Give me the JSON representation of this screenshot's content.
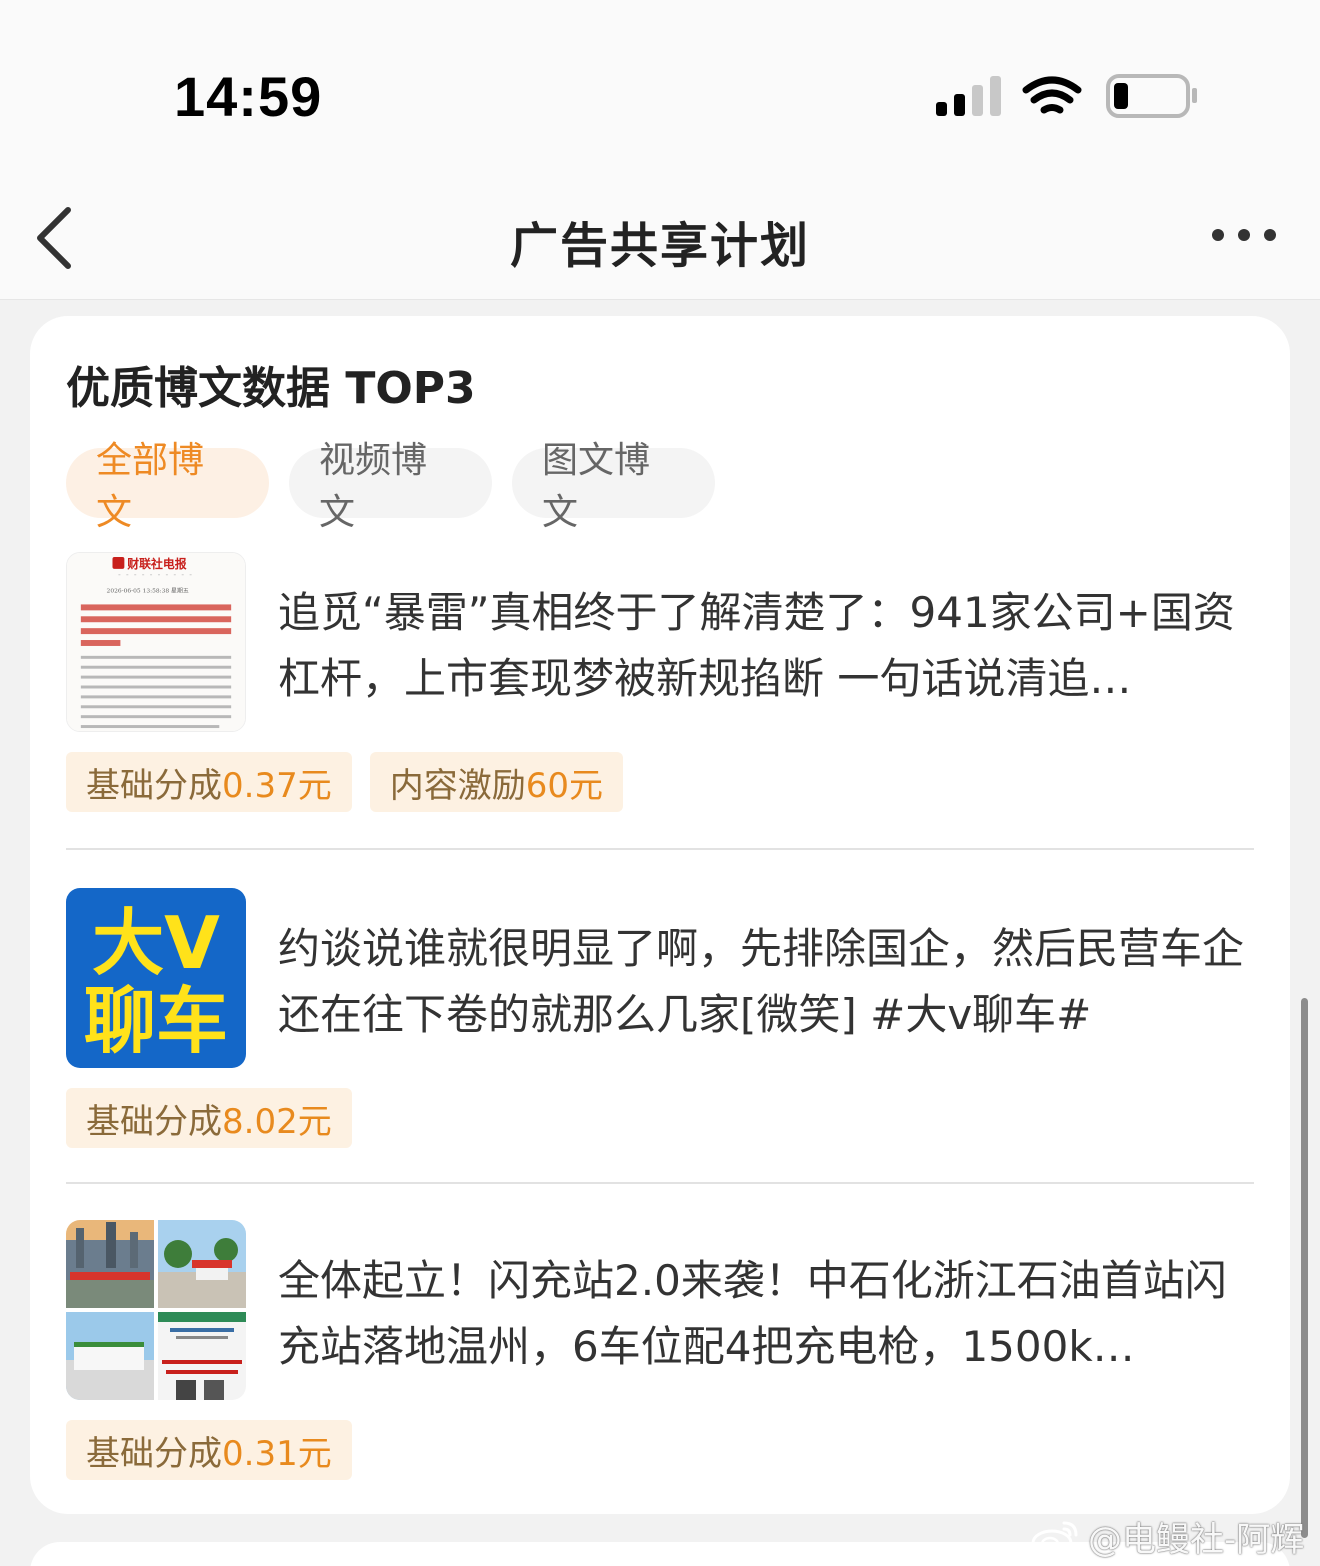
{
  "status_bar": {
    "time": "14:59"
  },
  "nav": {
    "title": "广告共享计划"
  },
  "section": {
    "title": "优质博文数据 TOP3",
    "tabs": [
      {
        "label": "全部博文",
        "active": true
      },
      {
        "label": "视频博文",
        "active": false
      },
      {
        "label": "图文博文",
        "active": false
      }
    ]
  },
  "posts": [
    {
      "thumb": {
        "kind": "news-document",
        "header": "财联社电报",
        "dateline": "2026-06-05 13:58:38 星期五",
        "headline": "【独家|有地方摸排辖区企业与追觅合作情况？地方人士回应：系市里统一部署，其所在区域初排没有相关的情况】"
      },
      "text": "追觅“暴雷”真相终于了解清楚了：941家公司+国资杠杆，上市套现梦被新规掐断 一句话说清追…",
      "badges": [
        {
          "label": "基础分成",
          "amount": "0.37元"
        },
        {
          "label": "内容激励",
          "amount": "60元"
        }
      ]
    },
    {
      "thumb": {
        "kind": "logo",
        "line1": "大V",
        "line2": "聊车",
        "bg": "#1467c8",
        "fg": "#ffe21a"
      },
      "text": "约谈说谁就很明显了啊，先排除国企，然后民营车企还在往下卷的就那么几家[微笑] #大v聊车#",
      "badges": [
        {
          "label": "基础分成",
          "amount": "8.02元"
        }
      ]
    },
    {
      "thumb": {
        "kind": "photo-grid"
      },
      "text": "全体起立！闪充站2.0来袭！中石化浙江石油首站闪充站落地温州，6车位配4把充电枪，1500k…",
      "badges": [
        {
          "label": "基础分成",
          "amount": "0.31元"
        }
      ]
    }
  ],
  "watermark": {
    "text": "@电鳗社-阿辉"
  },
  "colors": {
    "accent": "#ee8a24",
    "active_tab_bg": "#fdf0e4",
    "badge_bg": "#fdf1e2",
    "page_bg": "#f2f2f2",
    "card_bg": "#ffffff"
  }
}
